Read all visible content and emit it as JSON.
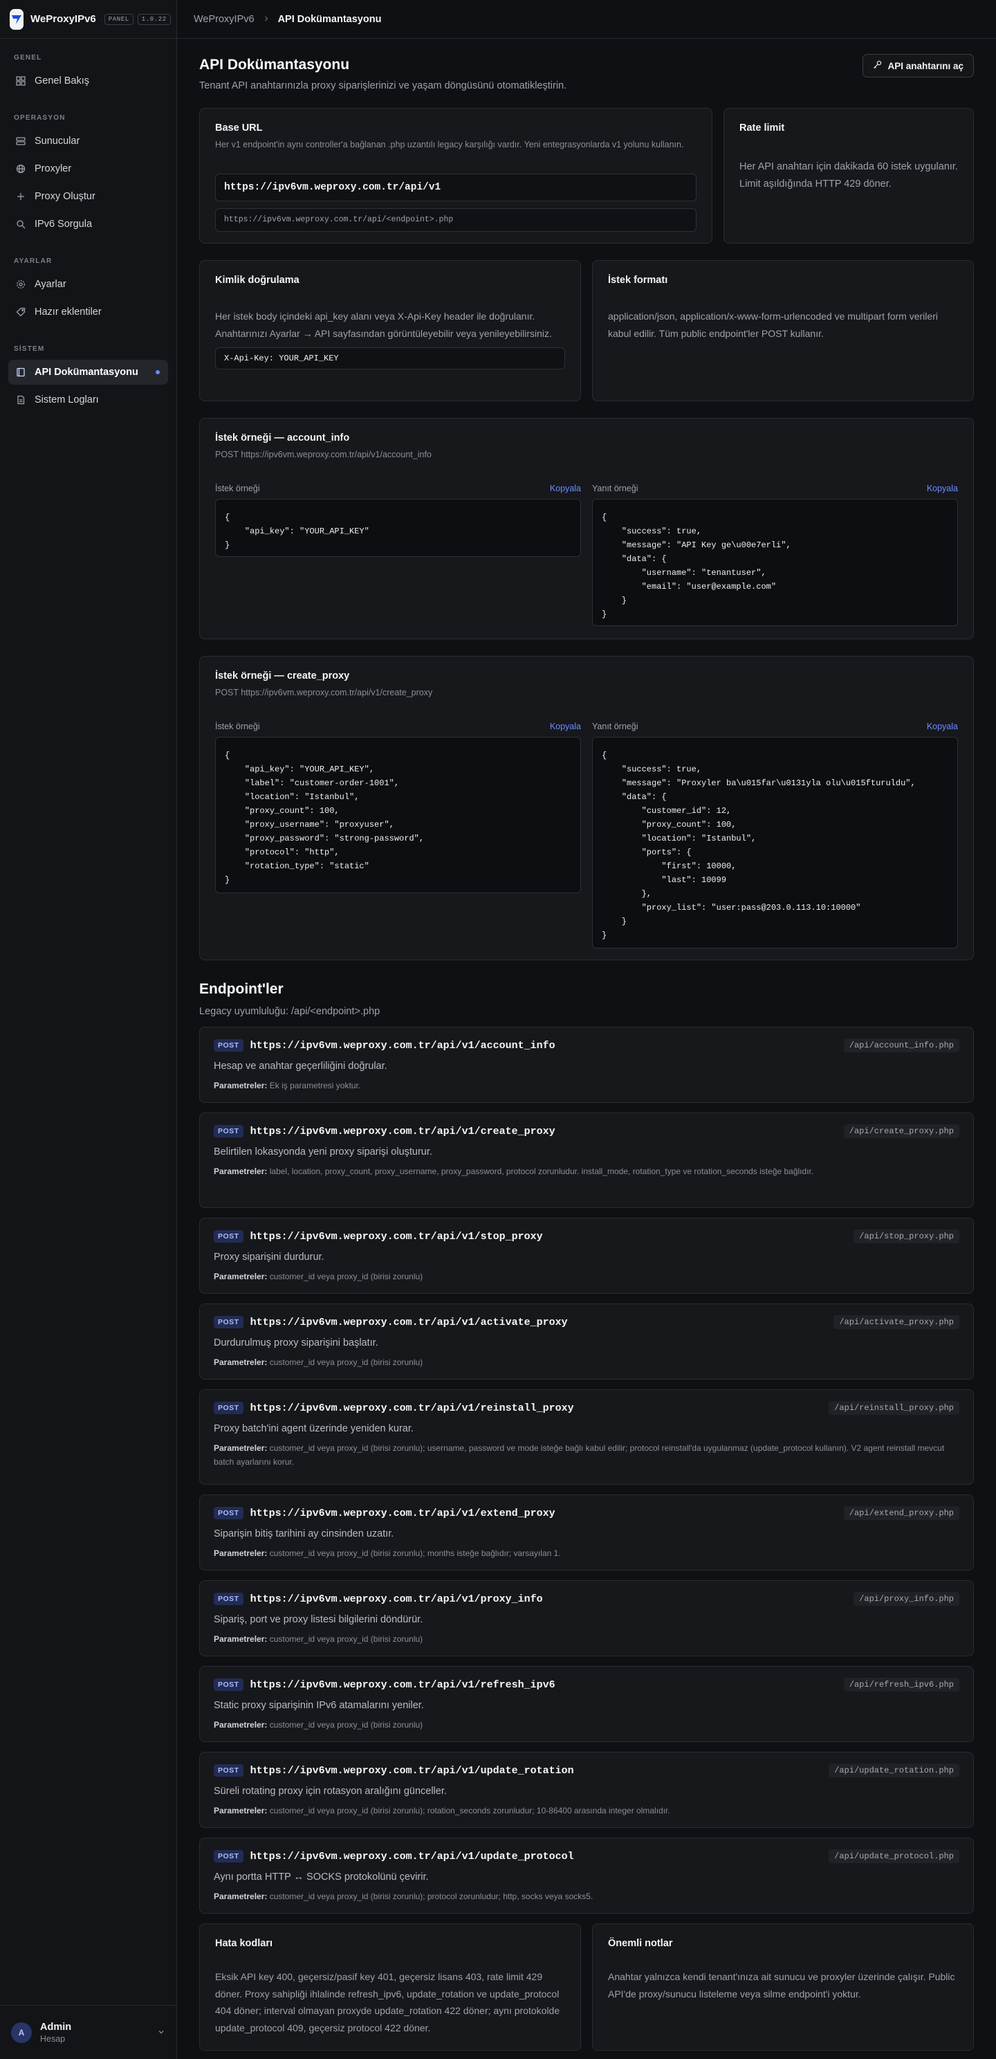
{
  "app": {
    "name": "WeProxyIPv6",
    "tag": "PANEL",
    "version": "1.0.22"
  },
  "sidebar": {
    "sections": [
      {
        "title": "GENEL",
        "items": [
          {
            "label": "Genel Bakış",
            "icon": "grid-icon"
          }
        ]
      },
      {
        "title": "OPERASYON",
        "items": [
          {
            "label": "Sunucular",
            "icon": "server-icon"
          },
          {
            "label": "Proxyler",
            "icon": "globe-icon"
          },
          {
            "label": "Proxy Oluştur",
            "icon": "plus-icon"
          },
          {
            "label": "IPv6 Sorgula",
            "icon": "search-icon"
          }
        ]
      },
      {
        "title": "AYARLAR",
        "items": [
          {
            "label": "Ayarlar",
            "icon": "gear-icon"
          },
          {
            "label": "Hazır eklentiler",
            "icon": "tag-icon"
          }
        ]
      },
      {
        "title": "SİSTEM",
        "items": [
          {
            "label": "API Dokümantasyonu",
            "icon": "book-icon",
            "active": true
          },
          {
            "label": "Sistem Logları",
            "icon": "file-icon"
          }
        ]
      }
    ],
    "user": {
      "initial": "A",
      "name": "Admin",
      "role": "Hesap"
    }
  },
  "breadcrumb": {
    "parent": "WeProxyIPv6",
    "current": "API Dokümantasyonu"
  },
  "page": {
    "title": "API Dokümantasyonu",
    "subtitle": "Tenant API anahtarınızla proxy siparişlerinizi ve yaşam döngüsünü otomatikleştirin.",
    "open_keys_label": "API anahtarını aç"
  },
  "base_url": {
    "title": "Base URL",
    "desc": "Her v1 endpoint'in aynı controller'a bağlanan .php uzantılı legacy karşılığı vardır. Yeni entegrasyonlarda v1 yolunu kullanın.",
    "primary": "https://ipv6vm.weproxy.com.tr/api/v1",
    "legacy": "https://ipv6vm.weproxy.com.tr/api/<endpoint>.php"
  },
  "rate_limit": {
    "title": "Rate limit",
    "text": "Her API anahtarı için dakikada 60 istek uygulanır. Limit aşıldığında HTTP 429 döner."
  },
  "auth": {
    "title": "Kimlik doğrulama",
    "text": "Her istek body içindeki api_key alanı veya X-Api-Key header ile doğrulanır. Anahtarınızı Ayarlar → API sayfasından görüntüleyebilir veya yenileyebilirsiniz.",
    "header_example": "X-Api-Key: YOUR_API_KEY"
  },
  "request_format": {
    "title": "İstek formatı",
    "text": "application/json, application/x-www-form-urlencoded ve multipart form verileri kabul edilir. Tüm public endpoint'ler POST kullanır."
  },
  "examples": [
    {
      "title": "İstek örneği — account_info",
      "endpoint": "POST https://ipv6vm.weproxy.com.tr/api/v1/account_info",
      "request_label": "İstek örneği",
      "response_label": "Yanıt örneği",
      "copy_label": "Kopyala",
      "request": "{\n    \"api_key\": \"YOUR_API_KEY\"\n}",
      "response": "{\n    \"success\": true,\n    \"message\": \"API Key ge\\u00e7erli\",\n    \"data\": {\n        \"username\": \"tenantuser\",\n        \"email\": \"user@example.com\"\n    }\n}"
    },
    {
      "title": "İstek örneği — create_proxy",
      "endpoint": "POST https://ipv6vm.weproxy.com.tr/api/v1/create_proxy",
      "request_label": "İstek örneği",
      "response_label": "Yanıt örneği",
      "copy_label": "Kopyala",
      "request": "{\n    \"api_key\": \"YOUR_API_KEY\",\n    \"label\": \"customer-order-1001\",\n    \"location\": \"Istanbul\",\n    \"proxy_count\": 100,\n    \"proxy_username\": \"proxyuser\",\n    \"proxy_password\": \"strong-password\",\n    \"protocol\": \"http\",\n    \"rotation_type\": \"static\"\n}",
      "response": "{\n    \"success\": true,\n    \"message\": \"Proxyler ba\\u015far\\u0131yla olu\\u015fturuldu\",\n    \"data\": {\n        \"customer_id\": 12,\n        \"proxy_count\": 100,\n        \"location\": \"Istanbul\",\n        \"ports\": {\n            \"first\": 10000,\n            \"last\": 10099\n        },\n        \"proxy_list\": \"user:pass@203.0.113.10:10000\"\n    }\n}"
    }
  ],
  "endpoints": {
    "title": "Endpoint'ler",
    "subtitle": "Legacy uyumluluğu: /api/<endpoint>.php",
    "method": "POST",
    "params_label": "Parametreler:",
    "items": [
      {
        "url": "https://ipv6vm.weproxy.com.tr/api/v1/account_info",
        "legacy": "/api/account_info.php",
        "desc": "Hesap ve anahtar geçerliliğini doğrular.",
        "params": "Ek iş parametresi yoktur."
      },
      {
        "url": "https://ipv6vm.weproxy.com.tr/api/v1/create_proxy",
        "legacy": "/api/create_proxy.php",
        "desc": "Belirtilen lokasyonda yeni proxy siparişi oluşturur.",
        "params": "label, location, proxy_count, proxy_username, proxy_password, protocol zorunludur. install_mode, rotation_type ve rotation_seconds isteğe bağlıdır."
      },
      {
        "url": "https://ipv6vm.weproxy.com.tr/api/v1/stop_proxy",
        "legacy": "/api/stop_proxy.php",
        "desc": "Proxy siparişini durdurur.",
        "params": "customer_id veya proxy_id (birisi zorunlu)"
      },
      {
        "url": "https://ipv6vm.weproxy.com.tr/api/v1/activate_proxy",
        "legacy": "/api/activate_proxy.php",
        "desc": "Durdurulmuş proxy siparişini başlatır.",
        "params": "customer_id veya proxy_id (birisi zorunlu)"
      },
      {
        "url": "https://ipv6vm.weproxy.com.tr/api/v1/reinstall_proxy",
        "legacy": "/api/reinstall_proxy.php",
        "desc": "Proxy batch'ini agent üzerinde yeniden kurar.",
        "params": "customer_id veya proxy_id (birisi zorunlu); username, password ve mode isteğe bağlı kabul edilir; protocol reinstall'da uygulanmaz (update_protocol kullanın). V2 agent reinstall mevcut batch ayarlarını korur."
      },
      {
        "url": "https://ipv6vm.weproxy.com.tr/api/v1/extend_proxy",
        "legacy": "/api/extend_proxy.php",
        "desc": "Siparişin bitiş tarihini ay cinsinden uzatır.",
        "params": "customer_id veya proxy_id (birisi zorunlu); months isteğe bağlıdır; varsayılan 1."
      },
      {
        "url": "https://ipv6vm.weproxy.com.tr/api/v1/proxy_info",
        "legacy": "/api/proxy_info.php",
        "desc": "Sipariş, port ve proxy listesi bilgilerini döndürür.",
        "params": "customer_id veya proxy_id (birisi zorunlu)"
      },
      {
        "url": "https://ipv6vm.weproxy.com.tr/api/v1/refresh_ipv6",
        "legacy": "/api/refresh_ipv6.php",
        "desc": "Static proxy siparişinin IPv6 atamalarını yeniler.",
        "params": "customer_id veya proxy_id (birisi zorunlu)"
      },
      {
        "url": "https://ipv6vm.weproxy.com.tr/api/v1/update_rotation",
        "legacy": "/api/update_rotation.php",
        "desc": "Süreli rotating proxy için rotasyon aralığını günceller.",
        "params": "customer_id veya proxy_id (birisi zorunlu); rotation_seconds zorunludur; 10-86400 arasında integer olmalıdır."
      },
      {
        "url": "https://ipv6vm.weproxy.com.tr/api/v1/update_protocol",
        "legacy": "/api/update_protocol.php",
        "desc": "Aynı portta HTTP ↔ SOCKS protokolünü çevirir.",
        "params": "customer_id veya proxy_id (birisi zorunlu); protocol zorunludur; http, socks veya socks5."
      }
    ]
  },
  "errors": {
    "title": "Hata kodları",
    "text": "Eksik API key 400, geçersiz/pasif key 401, geçersiz lisans 403, rate limit 429 döner. Proxy sahipliği ihlalinde refresh_ipv6, update_rotation ve update_protocol 404 döner; interval olmayan proxyde update_rotation 422 döner; aynı protokolde update_protocol 409, geçersiz protocol 422 döner."
  },
  "notes": {
    "title": "Önemli notlar",
    "text": "Anahtar yalnızca kendi tenant'ınıza ait sunucu ve proxyler üzerinde çalışır. Public API'de proxy/sunucu listeleme veya silme endpoint'i yoktur."
  }
}
